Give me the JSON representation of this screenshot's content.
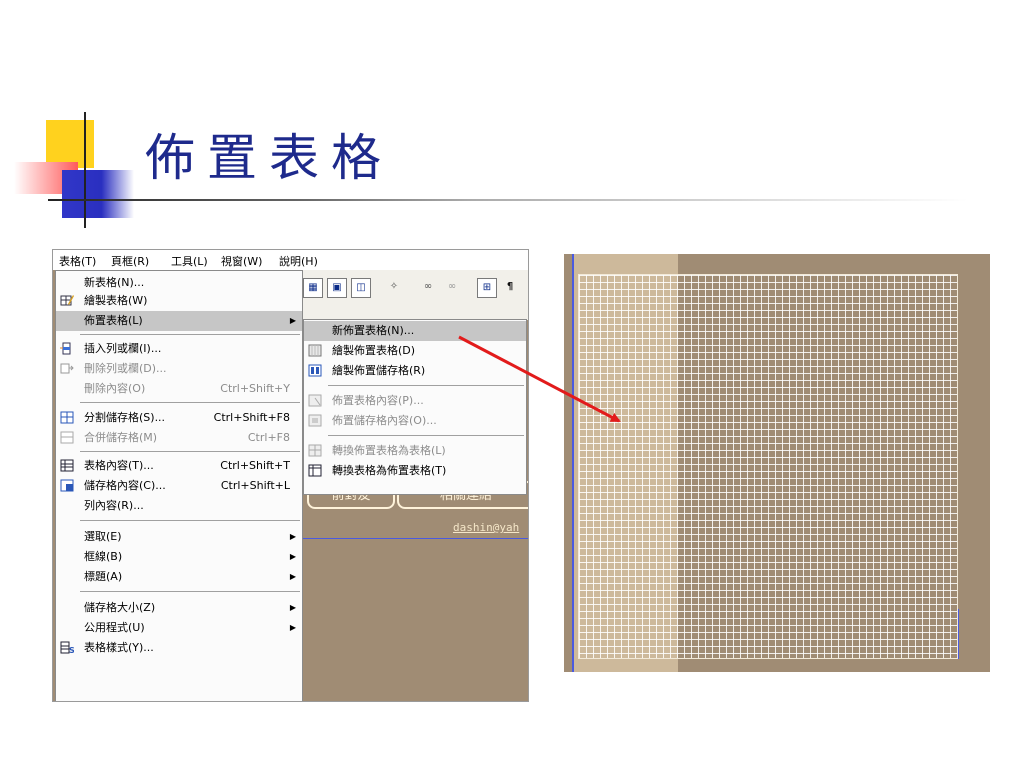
{
  "slide": {
    "title": "佈置表格"
  },
  "menubar": {
    "items": [
      "表格(T)",
      "頁框(R)",
      "工具(L)",
      "視窗(W)",
      "說明(H)"
    ]
  },
  "table_menu": {
    "items": [
      {
        "label": "新表格(N)...",
        "shortcut": "",
        "disabled": false,
        "has_submenu": false,
        "icon": ""
      },
      {
        "label": "繪製表格(W)",
        "shortcut": "",
        "disabled": false,
        "has_submenu": false,
        "icon": "draw-table-icon"
      },
      {
        "label": "佈置表格(L)",
        "shortcut": "",
        "disabled": false,
        "has_submenu": true,
        "icon": "",
        "highlighted": true
      },
      {
        "label": "插入列或欄(I)...",
        "shortcut": "",
        "disabled": false,
        "has_submenu": false,
        "icon": "insert-row-icon"
      },
      {
        "label": "刪除列或欄(D)...",
        "shortcut": "",
        "disabled": true,
        "has_submenu": false,
        "icon": "delete-row-icon"
      },
      {
        "label": "刪除內容(O)",
        "shortcut": "Ctrl+Shift+Y",
        "disabled": true,
        "has_submenu": false,
        "icon": ""
      },
      {
        "label": "分割儲存格(S)...",
        "shortcut": "Ctrl+Shift+F8",
        "disabled": false,
        "has_submenu": false,
        "icon": "split-cell-icon"
      },
      {
        "label": "合併儲存格(M)",
        "shortcut": "Ctrl+F8",
        "disabled": true,
        "has_submenu": false,
        "icon": "merge-cell-icon"
      },
      {
        "label": "表格內容(T)...",
        "shortcut": "Ctrl+Shift+T",
        "disabled": false,
        "has_submenu": false,
        "icon": "table-properties-icon"
      },
      {
        "label": "儲存格內容(C)...",
        "shortcut": "Ctrl+Shift+L",
        "disabled": false,
        "has_submenu": false,
        "icon": "cell-properties-icon"
      },
      {
        "label": "列內容(R)...",
        "shortcut": "",
        "disabled": false,
        "has_submenu": false,
        "icon": ""
      },
      {
        "label": "選取(E)",
        "shortcut": "",
        "disabled": false,
        "has_submenu": true,
        "icon": ""
      },
      {
        "label": "框線(B)",
        "shortcut": "",
        "disabled": false,
        "has_submenu": true,
        "icon": ""
      },
      {
        "label": "標題(A)",
        "shortcut": "",
        "disabled": false,
        "has_submenu": true,
        "icon": ""
      },
      {
        "label": "儲存格大小(Z)",
        "shortcut": "",
        "disabled": false,
        "has_submenu": true,
        "icon": ""
      },
      {
        "label": "公用程式(U)",
        "shortcut": "",
        "disabled": false,
        "has_submenu": true,
        "icon": ""
      },
      {
        "label": "表格樣式(Y)...",
        "shortcut": "",
        "disabled": false,
        "has_submenu": false,
        "icon": "table-style-icon"
      }
    ]
  },
  "layout_submenu": {
    "items": [
      {
        "label": "新佈置表格(N)...",
        "disabled": false,
        "highlighted": true,
        "icon": ""
      },
      {
        "label": "繪製佈置表格(D)",
        "disabled": false,
        "icon": "draw-layout-table-icon"
      },
      {
        "label": "繪製佈置儲存格(R)",
        "disabled": false,
        "icon": "draw-layout-cell-icon"
      },
      {
        "label": "佈置表格內容(P)...",
        "disabled": true,
        "icon": "layout-table-props-icon"
      },
      {
        "label": "佈置儲存格內容(O)...",
        "disabled": true,
        "icon": "layout-cell-props-icon"
      },
      {
        "label": "轉換佈置表格為表格(L)",
        "disabled": true,
        "icon": "convert-to-table-icon"
      },
      {
        "label": "轉換表格為佈置表格(T)",
        "disabled": false,
        "icon": "convert-to-layout-icon"
      }
    ]
  },
  "background_page": {
    "tabs": [
      "前對友",
      "相關連結"
    ],
    "email": "dashin@yah"
  },
  "toolbar": {
    "icons": [
      "table-icon",
      "frame-icon",
      "layout-icon",
      "find-icon",
      "link-icon",
      "unlink-icon",
      "border-icon",
      "pilcrow-icon"
    ]
  },
  "colors": {
    "title": "#1e2a8c",
    "page_bg": "#a08c74",
    "grid_light_column": "#cdb99b",
    "arrow": "#e21b1b",
    "menu_highlight": "#c6c6c6"
  }
}
